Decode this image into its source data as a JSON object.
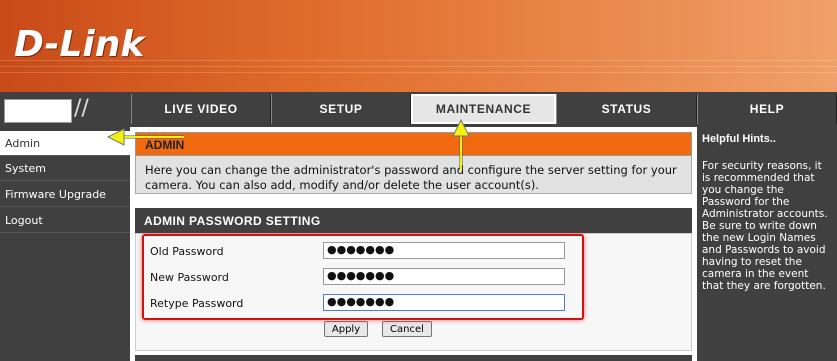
{
  "brand": {
    "logo": "D-Link"
  },
  "nav": {
    "tabs": [
      {
        "label": "LIVE VIDEO"
      },
      {
        "label": "SETUP"
      },
      {
        "label": "MAINTENANCE",
        "active": true
      },
      {
        "label": "STATUS"
      },
      {
        "label": "HELP"
      }
    ]
  },
  "sidebar": {
    "items": [
      {
        "label": "Admin",
        "active": true
      },
      {
        "label": "System"
      },
      {
        "label": "Firmware Upgrade"
      },
      {
        "label": "Logout"
      }
    ]
  },
  "admin": {
    "title": "ADMIN",
    "description": "Here you can change the administrator's password and configure the server setting for your camera. You can also add, modify and/or delete the user account(s)."
  },
  "password_section": {
    "title": "ADMIN PASSWORD SETTING",
    "fields": [
      {
        "label": "Old Password",
        "value": "●●●●●●●"
      },
      {
        "label": "New Password",
        "value": "●●●●●●●"
      },
      {
        "label": "Retype Password",
        "value": "●●●●●●●"
      }
    ],
    "apply_label": "Apply",
    "cancel_label": "Cancel"
  },
  "hints": {
    "title": "Helpful Hints..",
    "text": "For security reasons, it is recommended that you change the Password for the Administrator accounts. Be sure to write down the new Login Names and Passwords to avoid having to reset the camera in the event that they are forgotten."
  },
  "colors": {
    "accent": "#f26a10",
    "bar": "#404040",
    "annotation_arrow": "#f2f20a",
    "annotation_box": "#d21010"
  }
}
